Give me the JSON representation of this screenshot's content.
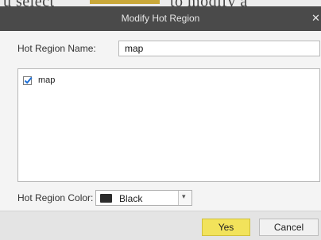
{
  "background_fragment": {
    "left_text": "u select",
    "right_text": "to modify a"
  },
  "dialog": {
    "title": "Modify Hot Region",
    "name_label": "Hot Region Name:",
    "name_value": "map",
    "list_items": [
      {
        "label": "map",
        "checked": true
      }
    ],
    "color_label": "Hot Region Color:",
    "color_value": "Black",
    "color_swatch": "#2b2b2b",
    "yes_label": "Yes",
    "cancel_label": "Cancel"
  },
  "icons": {
    "close": "close-icon",
    "dropdown": "chevron-down-icon",
    "check": "checkmark-icon"
  },
  "colors": {
    "titlebar": "#4a4a4a",
    "yes_button": "#f2e35b",
    "accent_check": "#1d6fd6"
  }
}
